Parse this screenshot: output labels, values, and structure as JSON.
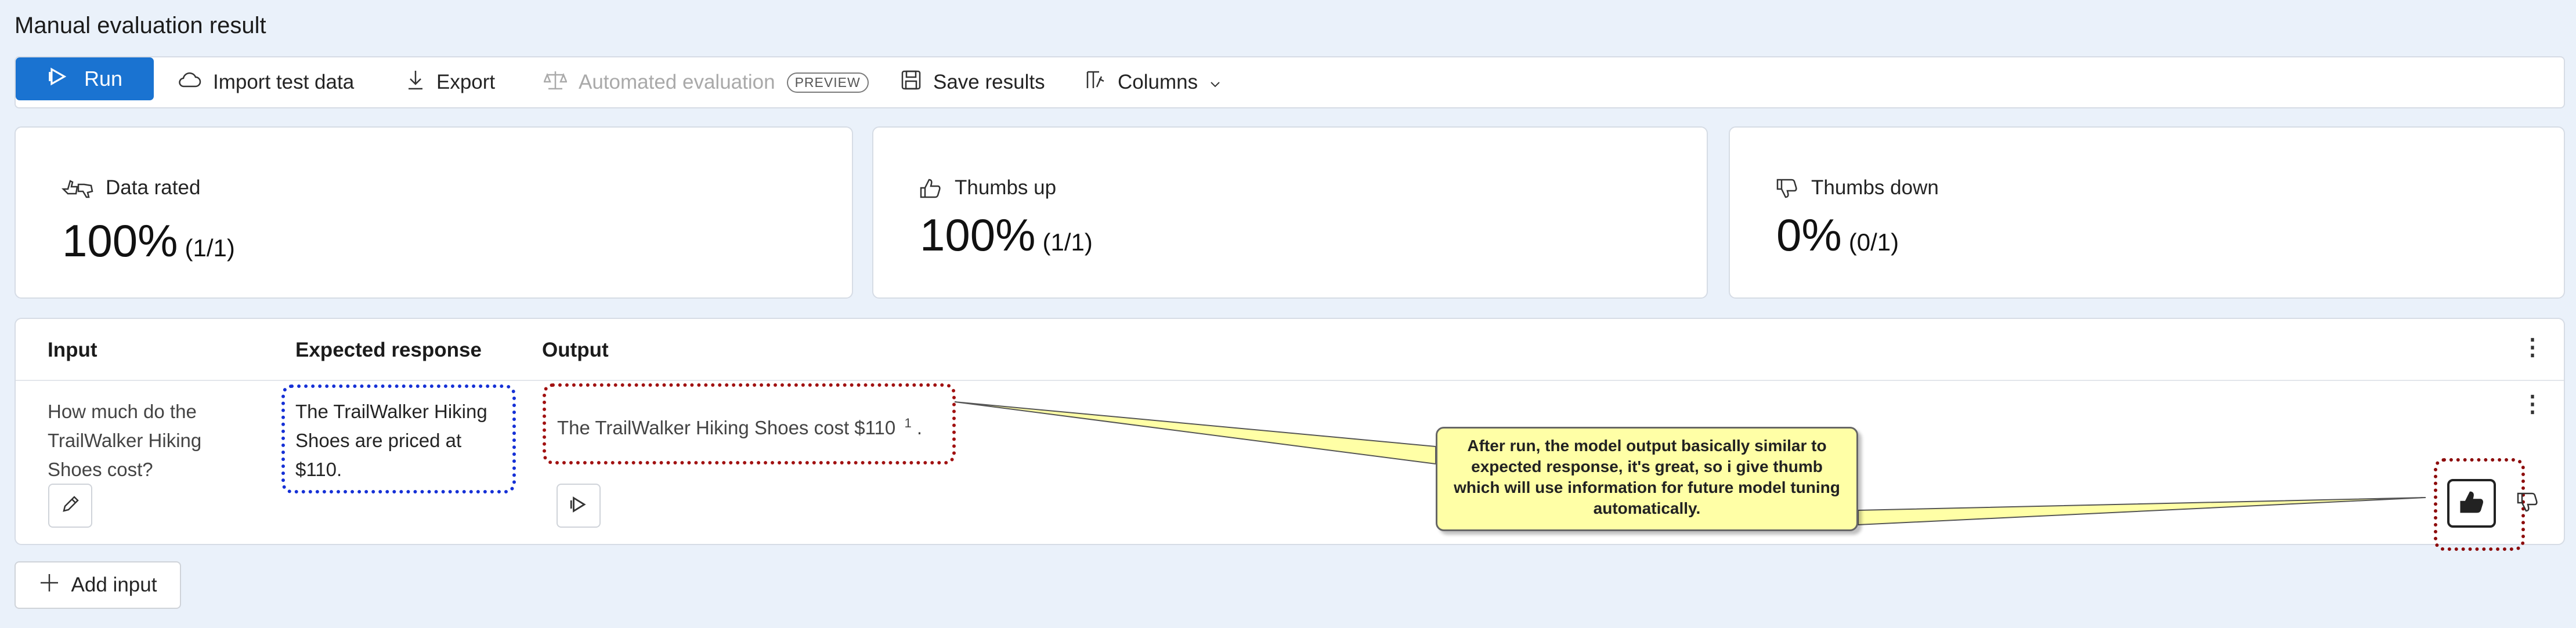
{
  "page": {
    "title": "Manual evaluation result"
  },
  "toolbar": {
    "run_label": "Run",
    "import_label": "Import test data",
    "export_label": "Export",
    "automated_label": "Automated evaluation",
    "preview_badge": "PREVIEW",
    "save_label": "Save results",
    "columns_label": "Columns"
  },
  "cards": {
    "data_rated": {
      "label": "Data rated",
      "value": "100%",
      "sub": "(1/1)"
    },
    "thumbs_up": {
      "label": "Thumbs up",
      "value": "100%",
      "sub": "(1/1)"
    },
    "thumbs_down": {
      "label": "Thumbs down",
      "value": "0%",
      "sub": "(0/1)"
    }
  },
  "table": {
    "headers": {
      "input": "Input",
      "expected": "Expected response",
      "output": "Output"
    },
    "rows": [
      {
        "input": "How much do the TrailWalker Hiking Shoes cost?",
        "expected": "The TrailWalker Hiking Shoes are priced at $110.",
        "output": "The TrailWalker Hiking Shoes cost $110",
        "citation": "1",
        "output_end": "."
      }
    ]
  },
  "annotation": {
    "text": "After run, the model output basically similar to expected response, it's great, so i give thumb which will use information for future model tuning automatically."
  },
  "footer": {
    "add_input_label": "Add input"
  },
  "colors": {
    "accent": "#1a73d1",
    "callout": "#ffffa6",
    "highlight_blue": "#1530d6",
    "highlight_red": "#a11111"
  }
}
